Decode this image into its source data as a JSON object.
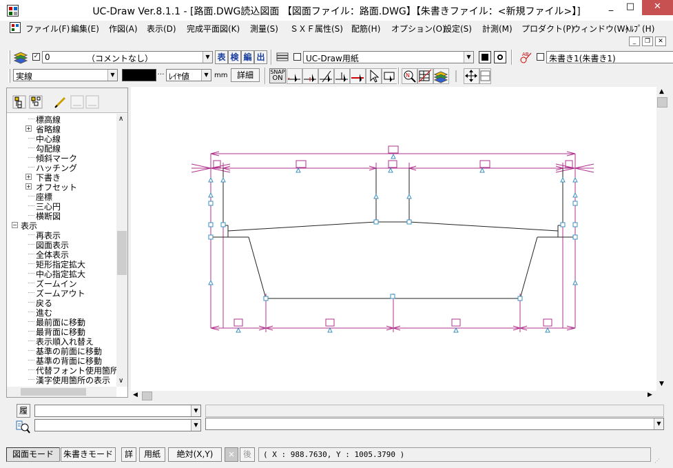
{
  "window": {
    "title": "UC-Draw Ver.8.1.1 - [路面.DWG読込図面 【図面ファイル：路面.DWG】【朱書きファイル：<新規ファイル>】]",
    "minimize": "_",
    "maximize": "□",
    "close": "✕"
  },
  "menu": [
    "ファイル(F)",
    "編集(E)",
    "作図(A)",
    "表示(D)",
    "完成平面図(K)",
    "測量(S)",
    "ＳＸＦ属性(S)",
    "配筋(H)",
    "オプション(O)",
    "設定(S)",
    "計測(M)",
    "プロダクト(P)",
    "ウィンドウ(W)",
    "ﾍﾙﾌﾟ(H)"
  ],
  "toolbar1": {
    "layer_value": "0",
    "layer_comment": "（コメントなし）",
    "btn_table": "表",
    "btn_check": "検",
    "btn_edit": "編",
    "btn_out": "出",
    "paper_value": "UC-Draw用紙",
    "redline_value": "朱書き1(朱書き1)"
  },
  "toolbar2": {
    "linetype": "実線",
    "linewidth": "ﾚｲﾔ値",
    "unit": "mm",
    "detail_btn": "詳細",
    "snap_top": "SNAP",
    "snap_bottom": "ON"
  },
  "tree": {
    "items": [
      {
        "label": "標高線",
        "expander": ""
      },
      {
        "label": "省略線",
        "expander": "+"
      },
      {
        "label": "中心線",
        "expander": ""
      },
      {
        "label": "勾配線",
        "expander": ""
      },
      {
        "label": "傾斜マーク",
        "expander": ""
      },
      {
        "label": "ハッチング",
        "expander": ""
      },
      {
        "label": "下書き",
        "expander": "+"
      },
      {
        "label": "オフセット",
        "expander": "+"
      },
      {
        "label": "座標",
        "expander": ""
      },
      {
        "label": "三心円",
        "expander": ""
      },
      {
        "label": "横断図",
        "expander": ""
      },
      {
        "label": "表示",
        "expander": "−",
        "level": 0
      },
      {
        "label": "再表示",
        "expander": ""
      },
      {
        "label": "図面表示",
        "expander": ""
      },
      {
        "label": "全体表示",
        "expander": ""
      },
      {
        "label": "矩形指定拡大",
        "expander": ""
      },
      {
        "label": "中心指定拡大",
        "expander": ""
      },
      {
        "label": "ズームイン",
        "expander": ""
      },
      {
        "label": "ズームアウト",
        "expander": ""
      },
      {
        "label": "戻る",
        "expander": ""
      },
      {
        "label": "進む",
        "expander": ""
      },
      {
        "label": "最前面に移動",
        "expander": ""
      },
      {
        "label": "最背面に移動",
        "expander": ""
      },
      {
        "label": "表示順入れ替え",
        "expander": ""
      },
      {
        "label": "基準の前面に移動",
        "expander": ""
      },
      {
        "label": "基準の背面に移動",
        "expander": ""
      },
      {
        "label": "代替フォント使用箇所",
        "expander": ""
      },
      {
        "label": "漢字使用箇所の表示",
        "expander": ""
      }
    ]
  },
  "bottom": {
    "history_label": "履",
    "history_value": "",
    "input_value": "",
    "command_value": ""
  },
  "status": {
    "mode_drawing": "図面モード",
    "mode_redline": "朱書きモード",
    "detail": "詳",
    "paper": "用紙",
    "absolute": "絶対(X,Y)",
    "x_btn": "×",
    "back_btn": "後",
    "coords": "( X : 988.7630, Y : 1005.3790 )"
  },
  "colors": {
    "dimension": "#b0308c",
    "outline": "#222222",
    "handle": "#3a8fbf",
    "close": "#c75050"
  }
}
